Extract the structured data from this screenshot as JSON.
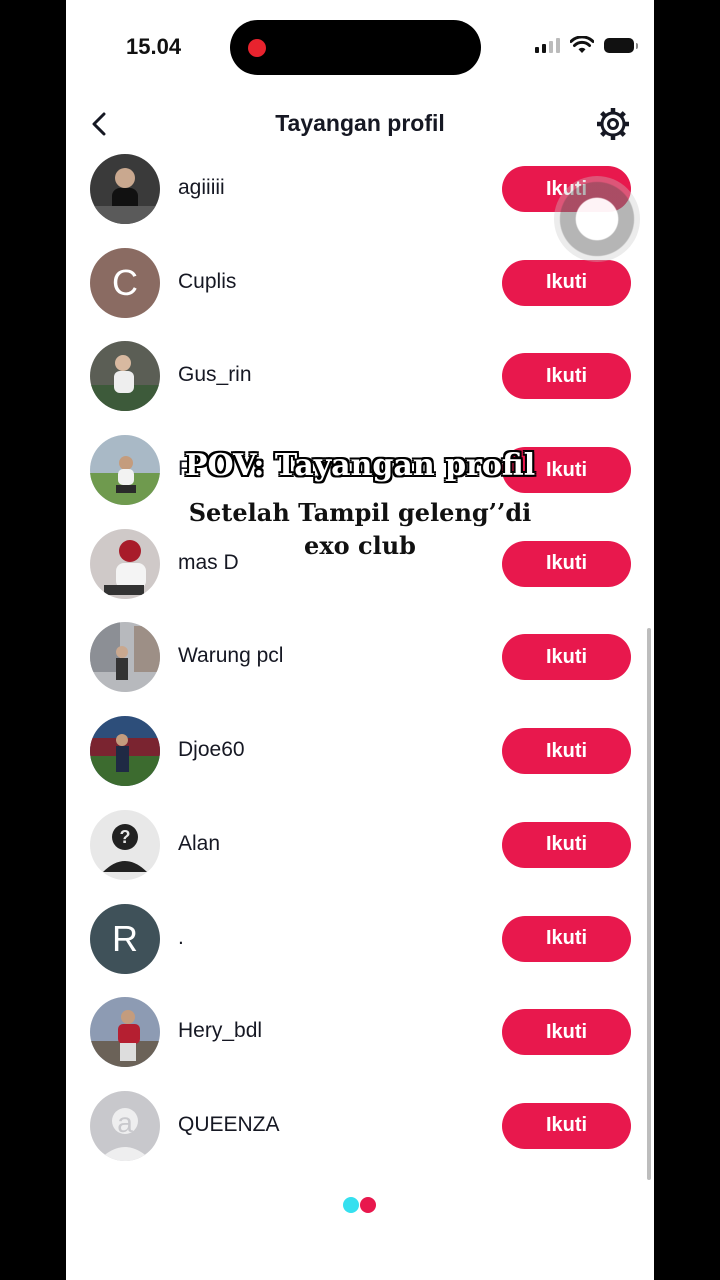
{
  "status_bar": {
    "time": "15.04"
  },
  "header": {
    "title": "Tayangan profil"
  },
  "follow_label": "Ikuti",
  "users": [
    {
      "name": "agiiiii",
      "avatar": {
        "kind": "photo",
        "bg": "#3a3a3a"
      }
    },
    {
      "name": "Cuplis",
      "avatar": {
        "kind": "letter",
        "letter": "C",
        "bg": "#8a6b62"
      }
    },
    {
      "name": "Gus_rin",
      "avatar": {
        "kind": "photo",
        "bg": "#5b5e55"
      }
    },
    {
      "name": "Fr",
      "avatar": {
        "kind": "photo",
        "bg": "#8aa372"
      }
    },
    {
      "name": "mas D",
      "avatar": {
        "kind": "photo",
        "bg": "#cfc9c8"
      }
    },
    {
      "name": "Warung pcl",
      "avatar": {
        "kind": "photo",
        "bg": "#9a9ca0"
      }
    },
    {
      "name": "Djoe60",
      "avatar": {
        "kind": "photo",
        "bg": "#2d4e7a"
      }
    },
    {
      "name": "Alan",
      "avatar": {
        "kind": "placeholder",
        "bg": "#e8e8e8"
      }
    },
    {
      "name": ".",
      "avatar": {
        "kind": "letter",
        "letter": "R",
        "bg": "#3f5159"
      }
    },
    {
      "name": "Hery_bdl",
      "avatar": {
        "kind": "photo",
        "bg": "#8d9bb3"
      }
    },
    {
      "name": "QUEENZA",
      "avatar": {
        "kind": "letter",
        "letter": "a",
        "bg": "#c8c8cc"
      }
    }
  ],
  "overlay": {
    "title": "POV: Tayangan profil",
    "subtitle": "Setelah Tampil geleng’’di exo club"
  },
  "colors": {
    "accent": "#e8184d",
    "loader_a": "#35e0ef",
    "loader_b": "#e8184d"
  }
}
